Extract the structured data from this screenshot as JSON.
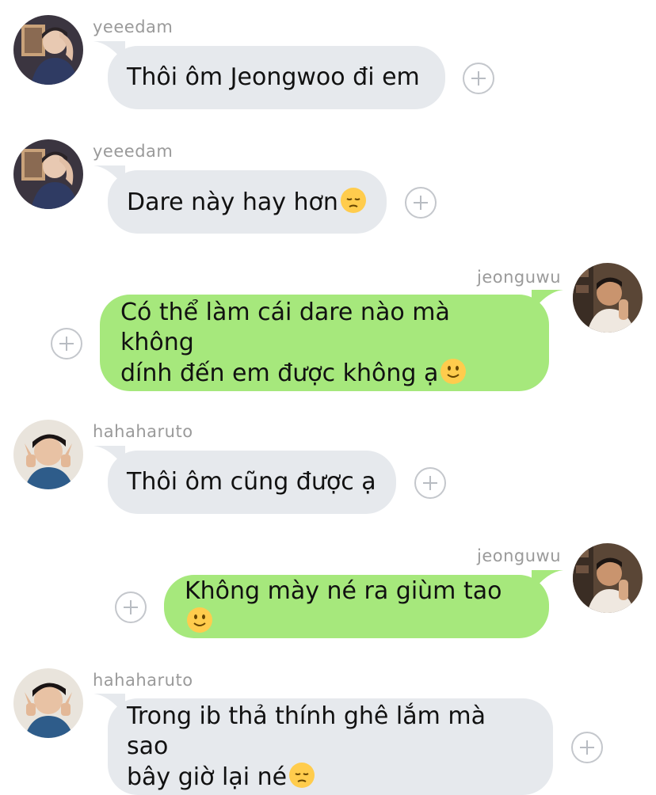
{
  "messages": [
    {
      "sender": "yeeedam",
      "direction": "incoming",
      "text": "Thôi ôm Jeongwoo đi em",
      "emoji": "",
      "avatar_icon": "profile-photo-icon"
    },
    {
      "sender": "yeeedam",
      "direction": "incoming",
      "text": "Dare này hay hơn",
      "emoji": "pensive-face-emoji",
      "avatar_icon": "profile-photo-icon"
    },
    {
      "sender": "jeonguwu",
      "direction": "outgoing",
      "text": "Có thể làm cái dare nào mà không\ndính đến em được không ạ",
      "emoji": "slightly-smiling-face-emoji",
      "avatar_icon": "profile-photo-icon"
    },
    {
      "sender": "hahaharuto",
      "direction": "incoming",
      "text": "Thôi ôm cũng được ạ",
      "emoji": "",
      "avatar_icon": "profile-photo-icon"
    },
    {
      "sender": "jeonguwu",
      "direction": "outgoing",
      "text": "Không mày né ra giùm tao",
      "emoji": "slightly-smiling-face-emoji",
      "avatar_icon": "profile-photo-icon"
    },
    {
      "sender": "hahaharuto",
      "direction": "incoming",
      "text": "Trong ib thả thính ghê lắm mà sao\nbây giờ lại né",
      "emoji": "pensive-face-emoji",
      "avatar_icon": "profile-photo-icon"
    }
  ],
  "colors": {
    "incoming_bubble": "#e6e9ed",
    "outgoing_bubble": "#a6e87c",
    "username_text": "#9a9a9a",
    "plus_button": "#c4c7cc"
  }
}
